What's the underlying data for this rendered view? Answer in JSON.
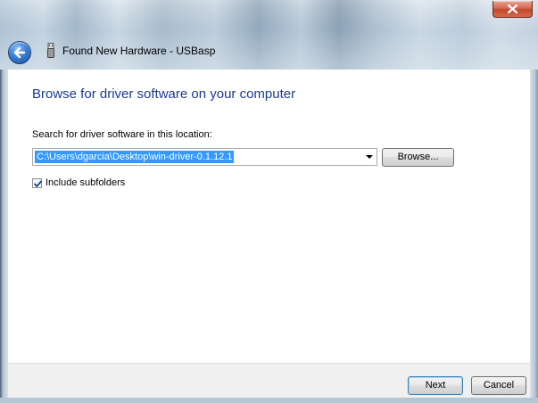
{
  "window": {
    "title": "Found New Hardware - USBasp"
  },
  "main": {
    "heading": "Browse for driver software on your computer",
    "search_label": "Search for driver software in this location:",
    "path_value": "C:\\Users\\dgarcia\\Desktop\\win-driver-0.1.12.1",
    "browse_label": "Browse...",
    "include_subfolders": {
      "label": "Include subfolders",
      "checked": true
    }
  },
  "footer": {
    "next_label": "Next",
    "cancel_label": "Cancel"
  },
  "icons": {
    "back": "back-arrow-icon",
    "close": "close-icon",
    "hardware": "usb-device-icon",
    "dropdown": "chevron-down-icon",
    "check": "checkmark-icon"
  },
  "colors": {
    "heading": "#1c3a8e",
    "selection": "#3399ff",
    "close_button": "#c2462c"
  }
}
